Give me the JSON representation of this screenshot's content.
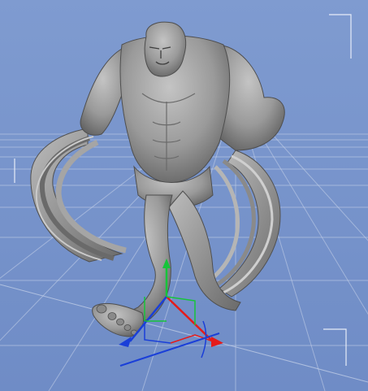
{
  "viewport": {
    "type": "3d-scene",
    "model": "muscular-creature-figure",
    "gizmo": "translate-axis-widget"
  },
  "colors": {
    "background_top": "#7f9bd0",
    "background_bottom": "#6f8cc6",
    "grid_line": "#c9d4ea",
    "model_light": "#b8b8b8",
    "model_mid": "#8f8f8f",
    "model_dark": "#4e4e4e",
    "axis_x": "#e41b1b",
    "axis_y": "#16c43a",
    "axis_z": "#1a3fd8",
    "corner_guides": "#e6ecf8"
  }
}
